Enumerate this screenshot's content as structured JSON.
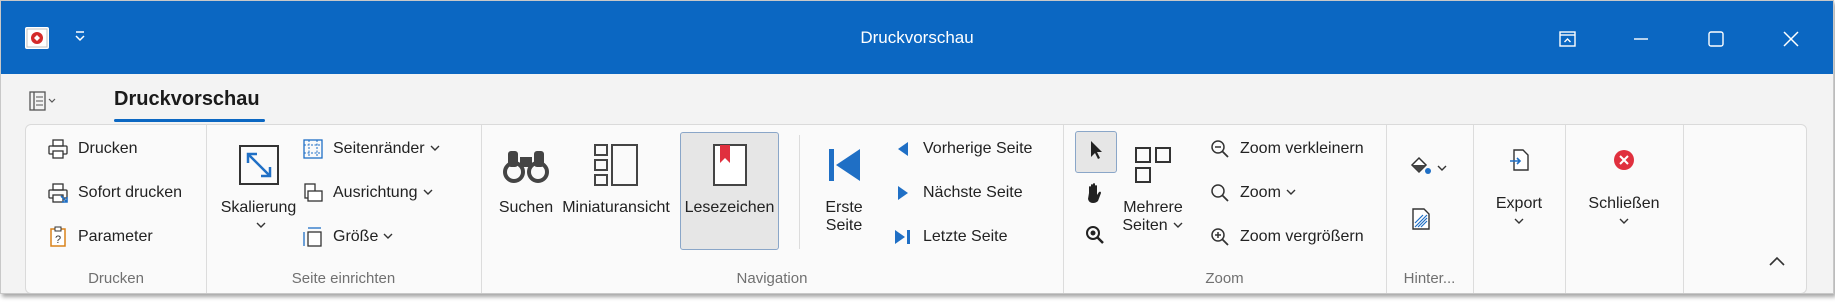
{
  "window": {
    "title": "Druckvorschau"
  },
  "tabs": {
    "active": "Druckvorschau"
  },
  "groups": {
    "drucken": {
      "label": "Drucken",
      "print": "Drucken",
      "quick_print": "Sofort drucken",
      "parameter": "Parameter"
    },
    "seite": {
      "label": "Seite einrichten",
      "scale_line1": "Skalierung",
      "margins": "Seitenränder",
      "orientation": "Ausrichtung",
      "size": "Größe"
    },
    "navigation": {
      "label": "Navigation",
      "search": "Suchen",
      "thumbnails": "Miniaturansicht",
      "bookmarks": "Lesezeichen",
      "first_line1": "Erste",
      "first_line2": "Seite",
      "prev": "Vorherige Seite",
      "next": "Nächste Seite",
      "last": "Letzte Seite"
    },
    "zoom": {
      "label": "Zoom",
      "multi_line1": "Mehrere",
      "multi_line2": "Seiten",
      "zoom_out": "Zoom verkleinern",
      "zoom": "Zoom",
      "zoom_in": "Zoom vergrößern"
    },
    "hintergrund": {
      "label": "Hinter..."
    },
    "export": {
      "label": "Export"
    },
    "close": {
      "label": "Schließen"
    }
  },
  "colors": {
    "titlebar": "#0b67c2",
    "accent": "#1f6fc5",
    "close_red": "#e0303e"
  },
  "icons": [
    "app-icon",
    "quick-access-dropdown-icon",
    "restore-ribbon-icon",
    "maximize-icon",
    "close-icon",
    "backstage-menu-icon",
    "printer-icon",
    "quick-print-icon",
    "parameter-icon",
    "scale-icon",
    "margins-icon",
    "orientation-icon",
    "size-icon",
    "binoculars-icon",
    "thumbnails-icon",
    "bookmark-icon",
    "first-page-icon",
    "previous-page-icon",
    "next-page-icon",
    "last-page-icon",
    "pointer-icon",
    "hand-icon",
    "magnifier-icon",
    "multiple-pages-icon",
    "zoom-out-icon",
    "zoom-icon",
    "zoom-in-icon",
    "page-color-icon",
    "watermark-icon",
    "export-icon",
    "close-preview-icon",
    "collapse-ribbon-icon"
  ]
}
